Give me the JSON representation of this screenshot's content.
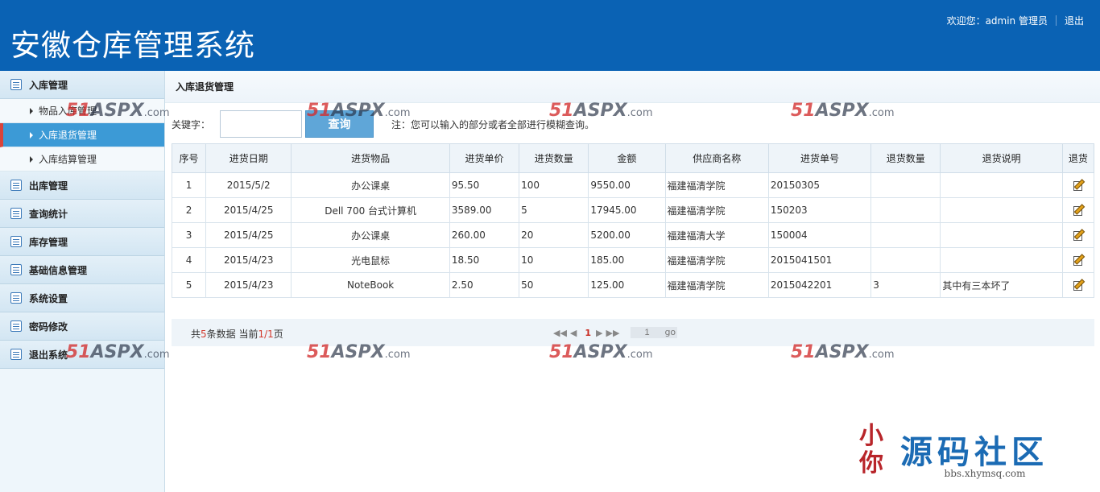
{
  "header": {
    "app_title": "安徽仓库管理系统",
    "welcome": "欢迎您：admin 管理员",
    "logout": "退出",
    "bg_color": "#0a62b4"
  },
  "sidebar": {
    "groups": [
      {
        "label": "入库管理",
        "icon": "list-icon"
      },
      {
        "label": "出库管理",
        "icon": "list-icon"
      },
      {
        "label": "查询统计",
        "icon": "list-icon"
      },
      {
        "label": "库存管理",
        "icon": "list-icon"
      },
      {
        "label": "基础信息管理",
        "icon": "list-icon"
      },
      {
        "label": "系统设置",
        "icon": "list-icon"
      },
      {
        "label": "密码修改",
        "icon": "list-icon"
      },
      {
        "label": "退出系统",
        "icon": "list-icon"
      }
    ],
    "sub_items": [
      {
        "label": "物品入库管理"
      },
      {
        "label": "入库退货管理",
        "active": true
      },
      {
        "label": "入库结算管理"
      }
    ]
  },
  "main": {
    "breadcrumb": "入库退货管理",
    "search": {
      "label": "关键字：",
      "value": "",
      "button": "查询",
      "hint": "注：您可以输入的部分或者全部进行模糊查询。"
    },
    "table": {
      "columns": [
        "序号",
        "进货日期",
        "进货物品",
        "进货单价",
        "进货数量",
        "金额",
        "供应商名称",
        "进货单号",
        "退货数量",
        "退货说明",
        "退货"
      ],
      "rows": [
        [
          "1",
          "2015/5/2",
          "办公课桌",
          "95.50",
          "100",
          "9550.00",
          "福建福清学院",
          "20150305",
          "",
          ""
        ],
        [
          "2",
          "2015/4/25",
          "Dell 700 台式计算机",
          "3589.00",
          "5",
          "17945.00",
          "福建福清学院",
          "150203",
          "",
          ""
        ],
        [
          "3",
          "2015/4/25",
          "办公课桌",
          "260.00",
          "20",
          "5200.00",
          "福建福清大学",
          "150004",
          "",
          ""
        ],
        [
          "4",
          "2015/4/23",
          "光电鼠标",
          "18.50",
          "10",
          "185.00",
          "福建福清学院",
          "2015041501",
          "",
          ""
        ],
        [
          "5",
          "2015/4/23",
          "NoteBook",
          "2.50",
          "50",
          "125.00",
          "福建福清学院",
          "2015042201",
          "3",
          "其中有三本坏了"
        ]
      ],
      "action_icon": "edit-icon"
    },
    "pager": {
      "prefix": "共",
      "total": "5",
      "mid": "条数据 当前",
      "page": "1/1",
      "suffix": "页",
      "current": "1",
      "jump_value": "1",
      "go": "go"
    }
  },
  "watermarks": {
    "num": "51",
    "brand": "ASPX",
    "suffix": ".com"
  },
  "badge": {
    "seal": "小你",
    "name": "源码社区",
    "url": "bbs.xhymsq.com"
  }
}
